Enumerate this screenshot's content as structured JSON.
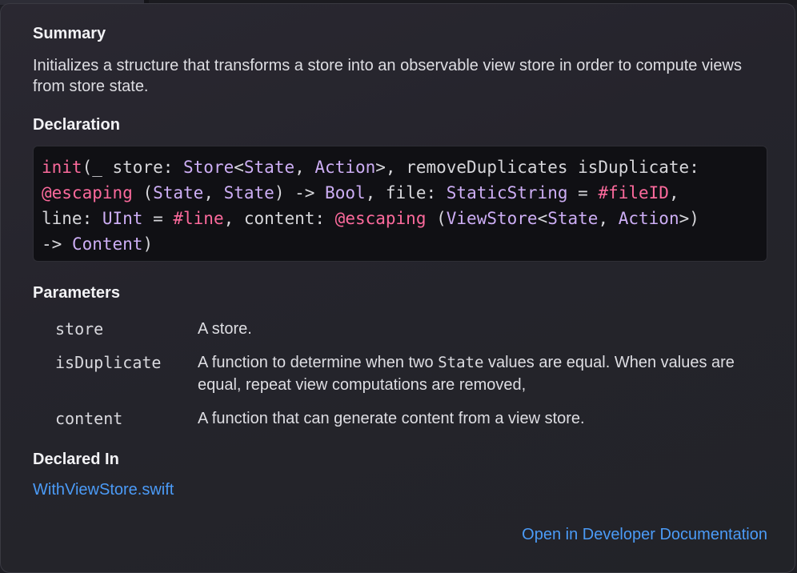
{
  "summary": {
    "title": "Summary",
    "text": "Initializes a structure that transforms a store into an observable view store in order to compute views from store state."
  },
  "declaration": {
    "title": "Declaration",
    "lines": [
      [
        {
          "t": "init",
          "c": "kw"
        },
        {
          "t": "(_ store: ",
          "c": "pl"
        },
        {
          "t": "Store",
          "c": "ty"
        },
        {
          "t": "<",
          "c": "pl"
        },
        {
          "t": "State",
          "c": "ty"
        },
        {
          "t": ", ",
          "c": "pl"
        },
        {
          "t": "Action",
          "c": "ty"
        },
        {
          "t": ">, removeDuplicates isDuplicate:",
          "c": "pl"
        }
      ],
      [
        {
          "t": "@escaping",
          "c": "kw"
        },
        {
          "t": " (",
          "c": "pl"
        },
        {
          "t": "State",
          "c": "ty"
        },
        {
          "t": ", ",
          "c": "pl"
        },
        {
          "t": "State",
          "c": "ty"
        },
        {
          "t": ") -> ",
          "c": "pl"
        },
        {
          "t": "Bool",
          "c": "ty"
        },
        {
          "t": ", file: ",
          "c": "pl"
        },
        {
          "t": "StaticString",
          "c": "ty"
        },
        {
          "t": " = ",
          "c": "pl"
        },
        {
          "t": "#fileID",
          "c": "kw"
        },
        {
          "t": ",",
          "c": "pl"
        }
      ],
      [
        {
          "t": "line: ",
          "c": "pl"
        },
        {
          "t": "UInt",
          "c": "ty"
        },
        {
          "t": " = ",
          "c": "pl"
        },
        {
          "t": "#line",
          "c": "kw"
        },
        {
          "t": ", content: ",
          "c": "pl"
        },
        {
          "t": "@escaping",
          "c": "kw"
        },
        {
          "t": " (",
          "c": "pl"
        },
        {
          "t": "ViewStore",
          "c": "ty"
        },
        {
          "t": "<",
          "c": "pl"
        },
        {
          "t": "State",
          "c": "ty"
        },
        {
          "t": ", ",
          "c": "pl"
        },
        {
          "t": "Action",
          "c": "ty"
        },
        {
          "t": ">)",
          "c": "pl"
        }
      ],
      [
        {
          "t": "-> ",
          "c": "pl"
        },
        {
          "t": "Content",
          "c": "ty"
        },
        {
          "t": ")",
          "c": "pl"
        }
      ]
    ]
  },
  "parameters": {
    "title": "Parameters",
    "items": [
      {
        "name": "store",
        "desc_parts": [
          {
            "t": "A store.",
            "mono": false
          }
        ]
      },
      {
        "name": "isDuplicate",
        "desc_parts": [
          {
            "t": "A function to determine when two ",
            "mono": false
          },
          {
            "t": "State",
            "mono": true
          },
          {
            "t": " values are equal. When values are equal, repeat view computations are removed,",
            "mono": false
          }
        ]
      },
      {
        "name": "content",
        "desc_parts": [
          {
            "t": "A function that can generate content from a view store.",
            "mono": false
          }
        ]
      }
    ]
  },
  "declared_in": {
    "title": "Declared In",
    "file_link": "WithViewStore.swift"
  },
  "footer": {
    "open_docs_link": "Open in Developer Documentation"
  },
  "colors": {
    "keyword": "#fc6a9c",
    "type": "#cdaef5",
    "link": "#4b9bf7"
  }
}
